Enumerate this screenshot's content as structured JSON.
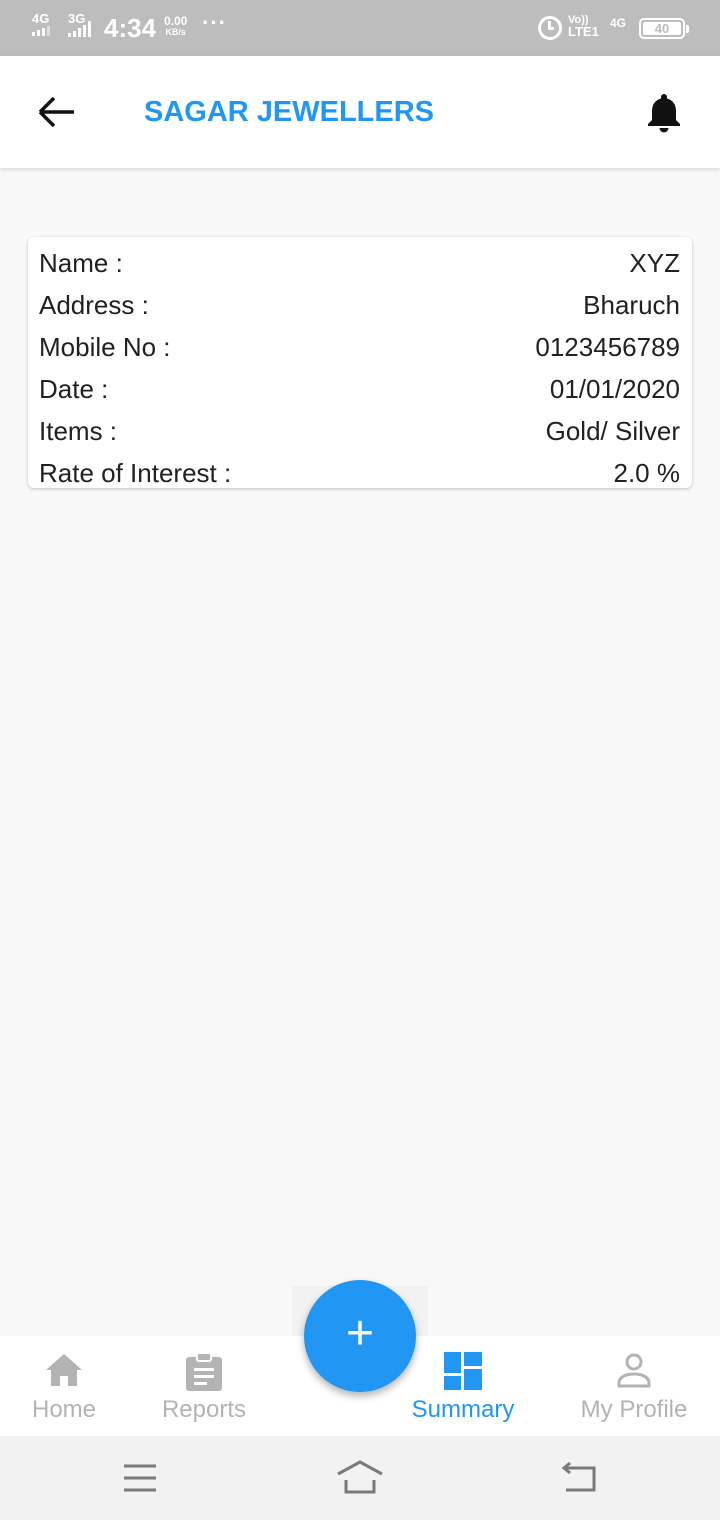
{
  "status_bar": {
    "network_1": "4G",
    "network_2": "3G",
    "time": "4:34",
    "speed_value": "0.00",
    "speed_unit": "KB/s",
    "more": "···",
    "volte": "Vo))",
    "lte": "LTE1",
    "network_3": "4G",
    "battery": "40"
  },
  "header": {
    "title": "SAGAR JEWELLERS",
    "back_icon": "arrow-left-icon",
    "notification_icon": "bell-icon"
  },
  "details": [
    {
      "label": "Name :",
      "value": "XYZ"
    },
    {
      "label": "Address :",
      "value": "Bharuch"
    },
    {
      "label": "Mobile No :",
      "value": "0123456789"
    },
    {
      "label": "Date :",
      "value": "01/01/2020"
    },
    {
      "label": "Items :",
      "value": "Gold/ Silver"
    },
    {
      "label": "Rate of Interest :",
      "value": "2.0 %"
    }
  ],
  "bottom_nav": {
    "items": [
      {
        "label": "Home",
        "icon": "home-icon",
        "active": false
      },
      {
        "label": "Reports",
        "icon": "clipboard-icon",
        "active": false
      },
      {
        "label": "Summary",
        "icon": "dashboard-icon",
        "active": true
      },
      {
        "label": "My Profile",
        "icon": "person-icon",
        "active": false
      }
    ],
    "fab_label": "+"
  },
  "colors": {
    "accent": "#2196f3",
    "inactive": "#b3b3b3",
    "status_bar": "#bdbdbd",
    "background": "#f8f8f8"
  }
}
